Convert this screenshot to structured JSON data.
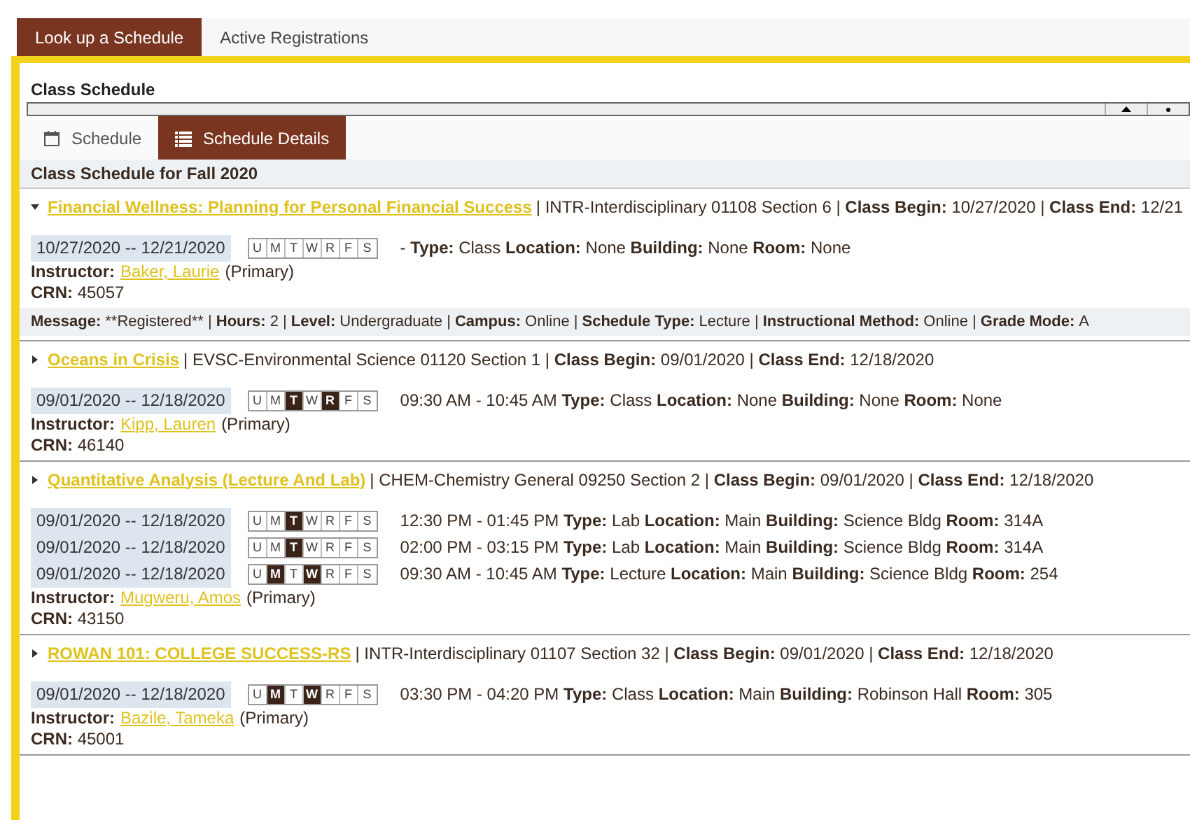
{
  "top_tabs": [
    {
      "label": "Look up a Schedule",
      "selected": true
    },
    {
      "label": "Active Registrations",
      "selected": false
    }
  ],
  "panel_title": "Class Schedule",
  "view_tabs": [
    {
      "label": "Schedule",
      "kind": "calendar",
      "selected": false
    },
    {
      "label": "Schedule Details",
      "kind": "list",
      "selected": true
    }
  ],
  "heading": "Class Schedule for Fall 2020",
  "courses": [
    {
      "title": "Financial Wellness: Planning for Personal Financial Success",
      "expanded": true,
      "info": "| INTR-Interdisciplinary 01108 Section 6 | **Class Begin:** 10/27/2020 | **Class End:** 12/21",
      "meetings": [
        {
          "dates": "10/27/2020 -- 12/21/2020",
          "days": [
            {
              "letter": "U",
              "selected": false
            },
            {
              "letter": "M",
              "selected": false
            },
            {
              "letter": "T",
              "selected": false
            },
            {
              "letter": "W",
              "selected": false
            },
            {
              "letter": "R",
              "selected": false
            },
            {
              "letter": "F",
              "selected": false
            },
            {
              "letter": "S",
              "selected": false
            }
          ],
          "details": "- **Type:** Class **Location:** None **Building:** None **Room:** None"
        }
      ],
      "instructor_label": "Instructor:",
      "instructor": "Baker, Laurie",
      "role": "(Primary)",
      "crn": "**CRN:** 45057",
      "message": [
        {
          "label": "Message:",
          "value": "**Registered** |"
        },
        {
          "label": "Hours:",
          "value": "2 |"
        },
        {
          "label": "Level:",
          "value": "Undergraduate |"
        },
        {
          "label": "Campus:",
          "value": "Online |"
        },
        {
          "label": "Schedule Type:",
          "value": "Lecture |"
        },
        {
          "label": "Instructional Method:",
          "value": "Online |"
        },
        {
          "label": "Grade Mode:",
          "value": "A"
        }
      ]
    },
    {
      "title": "Oceans in Crisis",
      "expanded": false,
      "info": "| EVSC-Environmental Science 01120 Section 1 | **Class Begin:** 09/01/2020 | **Class End:** 12/18/2020",
      "meetings": [
        {
          "dates": "09/01/2020 -- 12/18/2020",
          "days": [
            {
              "letter": "U",
              "selected": false
            },
            {
              "letter": "M",
              "selected": false
            },
            {
              "letter": "T",
              "selected": true
            },
            {
              "letter": "W",
              "selected": false
            },
            {
              "letter": "R",
              "selected": true
            },
            {
              "letter": "F",
              "selected": false
            },
            {
              "letter": "S",
              "selected": false
            }
          ],
          "details": "09:30 AM - 10:45 AM **Type:** Class **Location:** None **Building:** None **Room:** None"
        }
      ],
      "instructor_label": "Instructor:",
      "instructor": "Kipp, Lauren",
      "role": "(Primary)",
      "crn": "**CRN:** 46140"
    },
    {
      "title": "Quantitative Analysis (Lecture And Lab)",
      "expanded": false,
      "info": "| CHEM-Chemistry General 09250 Section 2 | **Class Begin:** 09/01/2020 | **Class End:** 12/18/2020",
      "meetings": [
        {
          "dates": "09/01/2020 -- 12/18/2020",
          "days": [
            {
              "letter": "U",
              "selected": false
            },
            {
              "letter": "M",
              "selected": false
            },
            {
              "letter": "T",
              "selected": true
            },
            {
              "letter": "W",
              "selected": false
            },
            {
              "letter": "R",
              "selected": false
            },
            {
              "letter": "F",
              "selected": false
            },
            {
              "letter": "S",
              "selected": false
            }
          ],
          "details": "12:30 PM - 01:45 PM **Type:** Lab **Location:** Main **Building:** Science Bldg **Room:** 314A"
        },
        {
          "dates": "09/01/2020 -- 12/18/2020",
          "days": [
            {
              "letter": "U",
              "selected": false
            },
            {
              "letter": "M",
              "selected": false
            },
            {
              "letter": "T",
              "selected": true
            },
            {
              "letter": "W",
              "selected": false
            },
            {
              "letter": "R",
              "selected": false
            },
            {
              "letter": "F",
              "selected": false
            },
            {
              "letter": "S",
              "selected": false
            }
          ],
          "details": "02:00 PM - 03:15 PM **Type:** Lab **Location:** Main **Building:** Science Bldg **Room:** 314A"
        },
        {
          "dates": "09/01/2020 -- 12/18/2020",
          "days": [
            {
              "letter": "U",
              "selected": false
            },
            {
              "letter": "M",
              "selected": true
            },
            {
              "letter": "T",
              "selected": false
            },
            {
              "letter": "W",
              "selected": true
            },
            {
              "letter": "R",
              "selected": false
            },
            {
              "letter": "F",
              "selected": false
            },
            {
              "letter": "S",
              "selected": false
            }
          ],
          "details": "09:30 AM - 10:45 AM **Type:** Lecture **Location:** Main **Building:** Science Bldg **Room:** 254"
        }
      ],
      "instructor_label": "Instructor:",
      "instructor": "Mugweru, Amos",
      "role": "(Primary)",
      "crn": "**CRN:** 43150"
    },
    {
      "title": "ROWAN 101: COLLEGE SUCCESS-RS",
      "expanded": false,
      "info": "| INTR-Interdisciplinary 01107 Section 32 | **Class Begin:** 09/01/2020 | **Class End:** 12/18/2020",
      "meetings": [
        {
          "dates": "09/01/2020 -- 12/18/2020",
          "days": [
            {
              "letter": "U",
              "selected": false
            },
            {
              "letter": "M",
              "selected": true
            },
            {
              "letter": "T",
              "selected": false
            },
            {
              "letter": "W",
              "selected": true
            },
            {
              "letter": "R",
              "selected": false
            },
            {
              "letter": "F",
              "selected": false
            },
            {
              "letter": "S",
              "selected": false
            }
          ],
          "details": "03:30 PM - 04:20 PM **Type:** Class **Location:** Main **Building:** Robinson Hall **Room:** 305"
        }
      ],
      "instructor_label": "Instructor:",
      "instructor": "Bazile, Tameka",
      "role": "(Primary)",
      "crn": "**CRN:** 45001"
    }
  ]
}
